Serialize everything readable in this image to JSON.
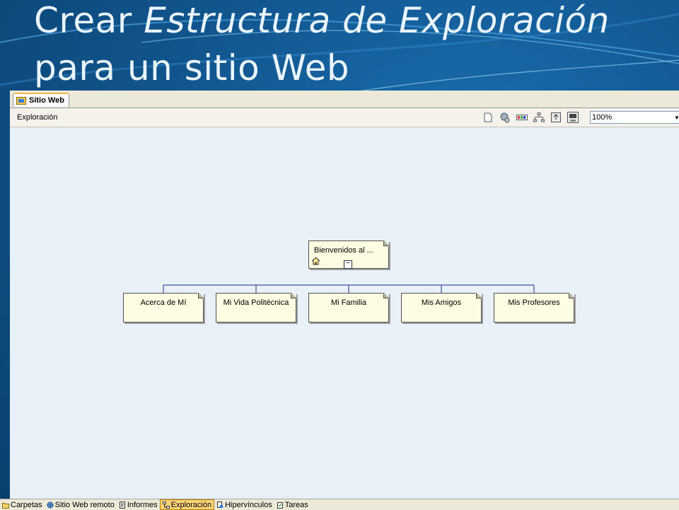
{
  "slide": {
    "title_prefix": "Crear ",
    "title_emphasis": "Estructura de Exploración",
    "title_line2": "para un sitio Web"
  },
  "app": {
    "document_tab": "Sitio Web",
    "view_label": "Exploración",
    "zoom": "100%",
    "toolbar_icons": [
      "new-page-icon",
      "web-settings-icon",
      "color-bar-icon",
      "org-chart-icon",
      "upload-icon",
      "options-icon"
    ]
  },
  "nav_map": {
    "root": {
      "label": "Bienvenidos al ..."
    },
    "children": [
      {
        "label": "Acerca de Mí"
      },
      {
        "label": "Mi Vida Politécnica"
      },
      {
        "label": "Mi Familia"
      },
      {
        "label": "Mis Amigos"
      },
      {
        "label": "Mis Profesores"
      }
    ]
  },
  "views_bar": [
    {
      "label": "Carpetas",
      "icon": "folder-icon",
      "active": false
    },
    {
      "label": "Sitio Web remoto",
      "icon": "remote-site-icon",
      "active": false
    },
    {
      "label": "Informes",
      "icon": "reports-icon",
      "active": false
    },
    {
      "label": "Exploración",
      "icon": "navigation-icon",
      "active": true
    },
    {
      "label": "Hipervínculos",
      "icon": "hyperlinks-icon",
      "active": false
    },
    {
      "label": "Tareas",
      "icon": "tasks-icon",
      "active": false
    }
  ],
  "colors": {
    "slide_bg": "#11568f",
    "title": "#e9f4fc",
    "connector": "#1a2f8c",
    "node_fill": "#fdfde3",
    "active_tab": "#ffd57a"
  }
}
